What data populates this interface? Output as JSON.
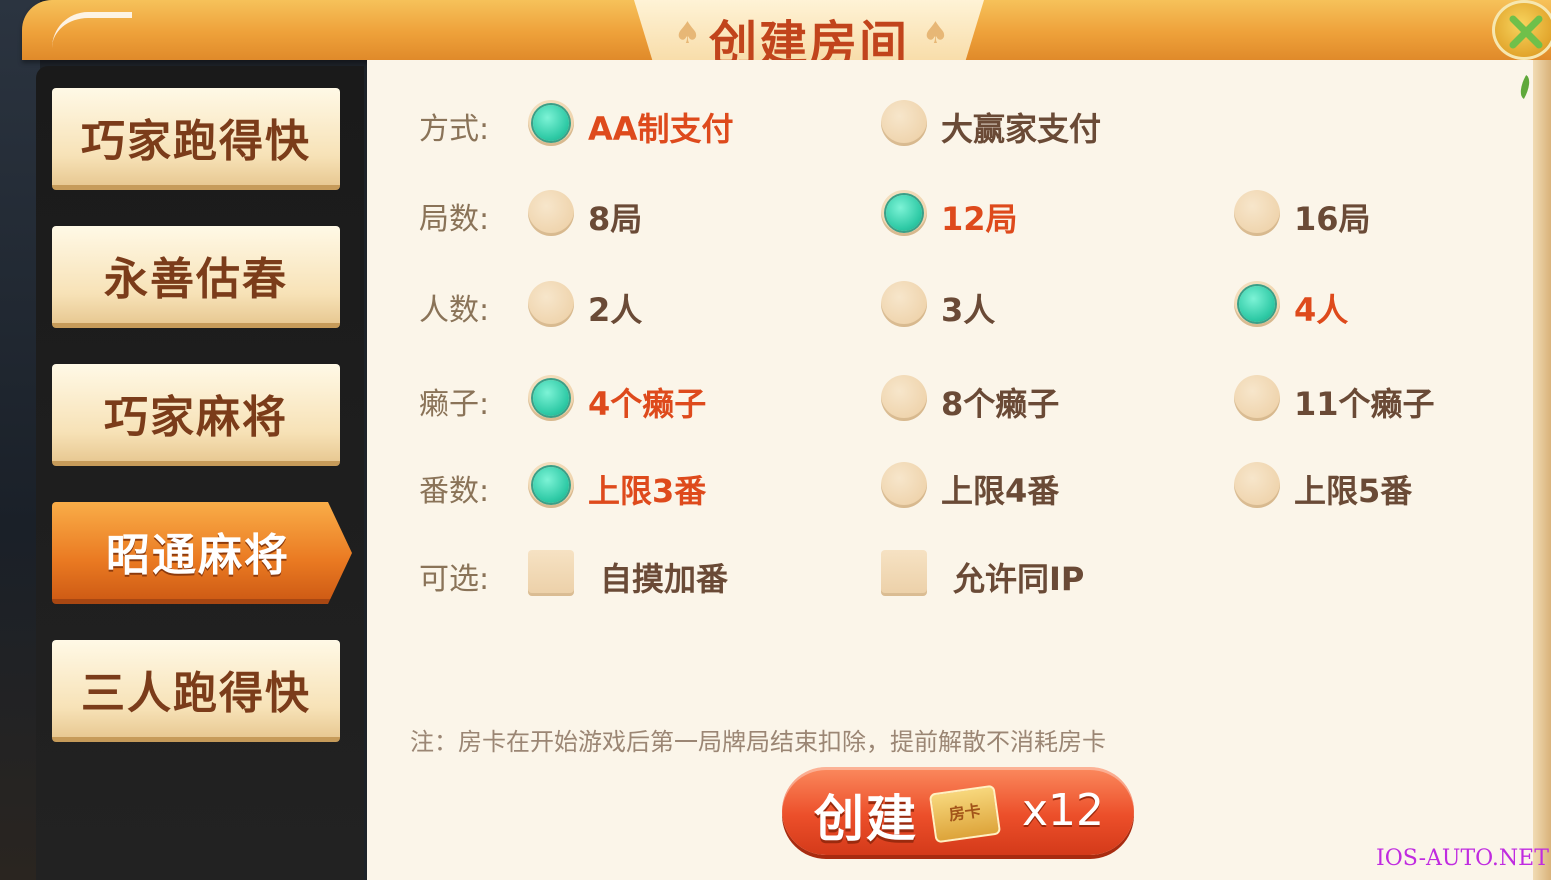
{
  "title": "创建房间",
  "header": {
    "suit_left": "♠",
    "suit_right": "♠"
  },
  "sidebar": {
    "tabs": [
      {
        "label": "巧家跑得快",
        "active": false
      },
      {
        "label": "永善估春",
        "active": false
      },
      {
        "label": "巧家麻将",
        "active": false
      },
      {
        "label": "昭通麻将",
        "active": true
      },
      {
        "label": "三人跑得快",
        "active": false
      }
    ]
  },
  "settings": {
    "payment": {
      "label": "方式:",
      "options": [
        {
          "text": "AA制支付",
          "selected": true
        },
        {
          "text": "大赢家支付",
          "selected": false
        }
      ]
    },
    "rounds": {
      "label": "局数:",
      "options": [
        {
          "text": "8局",
          "selected": false
        },
        {
          "text": "12局",
          "selected": true
        },
        {
          "text": "16局",
          "selected": false
        }
      ]
    },
    "players": {
      "label": "人数:",
      "options": [
        {
          "text": "2人",
          "selected": false
        },
        {
          "text": "3人",
          "selected": false
        },
        {
          "text": "4人",
          "selected": true
        }
      ]
    },
    "wildcards": {
      "label": "癞子:",
      "options": [
        {
          "text": "4个癞子",
          "selected": true
        },
        {
          "text": "8个癞子",
          "selected": false
        },
        {
          "text": "11个癞子",
          "selected": false
        }
      ]
    },
    "fan": {
      "label": "番数:",
      "options": [
        {
          "text": "上限3番",
          "selected": true
        },
        {
          "text": "上限4番",
          "selected": false
        },
        {
          "text": "上限5番",
          "selected": false
        }
      ]
    },
    "optional": {
      "label": "可选:",
      "options": [
        {
          "text": "自摸加番",
          "checked": false
        },
        {
          "text": "允许同IP",
          "checked": false
        }
      ]
    }
  },
  "note": "注：房卡在开始游戏后第一局牌局结束扣除，提前解散不消耗房卡",
  "create_button": {
    "label": "创建",
    "card_label": "房卡",
    "count": "x12"
  },
  "watermark": "IOS-AUTO.NET",
  "colors": {
    "accent": "#ea7a22",
    "selected_text": "#de4a1c",
    "radio_on": "#2fcaa6"
  }
}
